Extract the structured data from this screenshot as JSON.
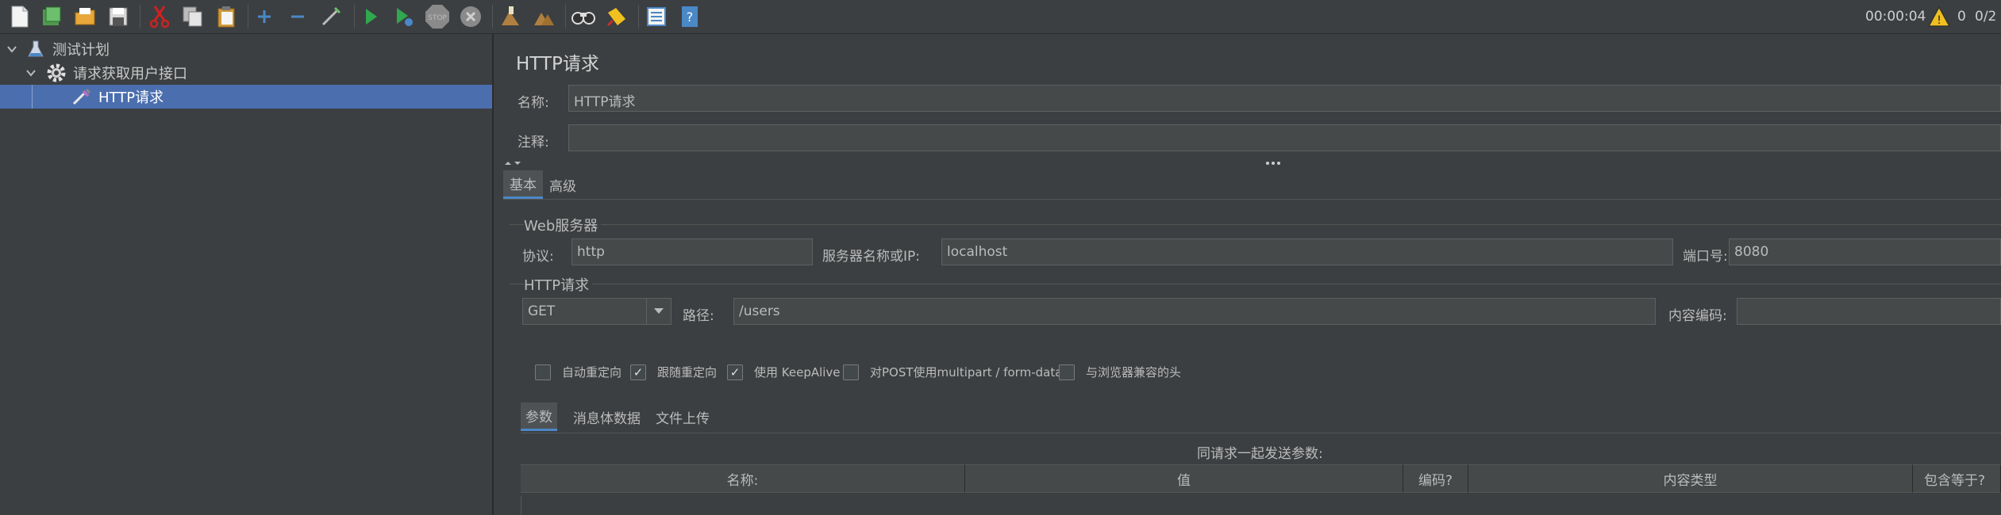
{
  "toolbar": {
    "icons": [
      "new-icon",
      "templates-icon",
      "open-icon",
      "save-icon",
      "cut-icon",
      "copy-icon",
      "paste-icon",
      "expand-icon",
      "collapse-icon",
      "toggle-icon",
      "start-icon",
      "start-no-pause-icon",
      "stop-icon",
      "shutdown-icon",
      "clear-icon",
      "clear-all-icon",
      "search-icon",
      "reset-search-icon",
      "function-helper-icon",
      "help-icon"
    ],
    "timer": "00:00:04",
    "warnings_count": "0",
    "threads": "0/2"
  },
  "tree": {
    "items": [
      {
        "label": "测试计划",
        "icon": "flask-icon"
      },
      {
        "label": "请求获取用户接口",
        "icon": "gear-icon"
      },
      {
        "label": "HTTP请求",
        "icon": "pipette-icon"
      }
    ]
  },
  "panel": {
    "title": "HTTP请求",
    "name_label": "名称:",
    "name_value": "HTTP请求",
    "comment_label": "注释:",
    "comment_value": "",
    "tabs": [
      "基本",
      "高级"
    ],
    "web_server": {
      "group_title": "Web服务器",
      "protocol_label": "协议:",
      "protocol_value": "http",
      "server_label": "服务器名称或IP:",
      "server_value": "localhost",
      "port_label": "端口号:",
      "port_value": "8080"
    },
    "http_request": {
      "group_title": "HTTP请求",
      "method": "GET",
      "path_label": "路径:",
      "path_value": "/users",
      "encoding_label": "内容编码:",
      "encoding_value": ""
    },
    "options": [
      {
        "label": "自动重定向",
        "checked": false
      },
      {
        "label": "跟随重定向",
        "checked": true
      },
      {
        "label": "使用 KeepAlive",
        "checked": true
      },
      {
        "label": "对POST使用multipart / form-data",
        "checked": false
      },
      {
        "label": "与浏览器兼容的头",
        "checked": false
      }
    ],
    "sub_tabs": [
      "参数",
      "消息体数据",
      "文件上传"
    ],
    "params_caption": "同请求一起发送参数:",
    "columns": [
      "名称:",
      "值",
      "编码?",
      "内容类型",
      "包含等于?"
    ]
  },
  "colors": {
    "background": "#3c3f41",
    "selection": "#4b6eaf",
    "field_bg": "#45494a"
  }
}
